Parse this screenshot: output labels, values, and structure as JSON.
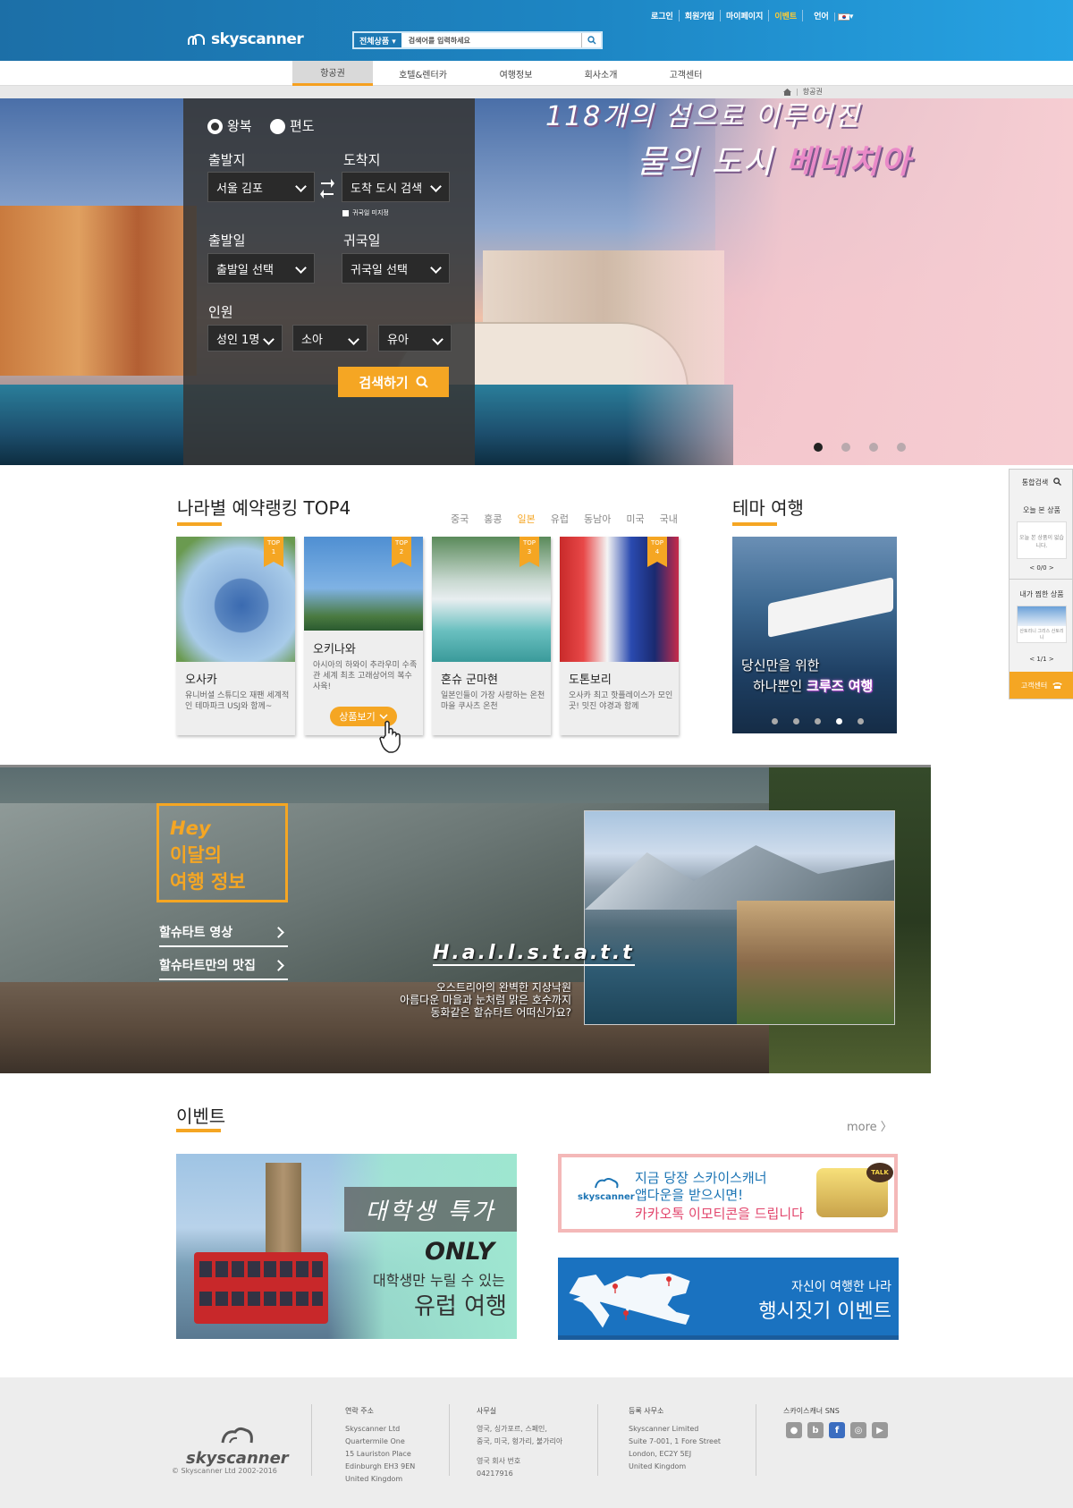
{
  "header": {
    "logo": "skyscanner",
    "search_category": "전체상품 ▾",
    "search_placeholder": "검색어를 입력하세요",
    "links": [
      "로그인",
      "회원가입",
      "마이페이지",
      "이벤트",
      "언어"
    ]
  },
  "nav": {
    "items": [
      "항공권",
      "호텔&렌터카",
      "여행정보",
      "회사소개",
      "고객센터"
    ],
    "active": "항공권"
  },
  "breadcrumb": {
    "current": "항공권"
  },
  "hero": {
    "title_line1": "118개의 섬으로 이루어진",
    "title_line2_prefix": "물의 도시",
    "title_line2_highlight": "베네치아",
    "slides": 4,
    "active_slide": 1
  },
  "booking": {
    "roundtrip": "왕복",
    "oneway": "편도",
    "from_label": "출발지",
    "from_value": "서울 김포",
    "to_label": "도착지",
    "to_value": "도착 도시 검색",
    "no_return": "귀국일 미지정",
    "depart_label": "출발일",
    "depart_value": "출발일 선택",
    "return_label": "귀국일",
    "return_value": "귀국일 선택",
    "people_label": "인원",
    "adult": "성인 1명",
    "child": "소아",
    "infant": "유아",
    "search_button": "검색하기"
  },
  "ranking": {
    "title": "나라별 예약랭킹 TOP4",
    "tabs": [
      "중국",
      "홍콩",
      "일본",
      "유럽",
      "동남아",
      "미국",
      "국내"
    ],
    "active_tab": "일본",
    "cards": [
      {
        "badge_top": "TOP",
        "badge_num": "1",
        "title": "오사카",
        "desc": "유니버셜 스튜디오 재팬 세계적인 테마파크 USJ와 함께~"
      },
      {
        "badge_top": "TOP",
        "badge_num": "2",
        "title": "오키나와",
        "desc": "아시아의 하와이 추라우미 수족관 세계 최초 고래상어의 복수 사육!",
        "button": "상품보기"
      },
      {
        "badge_top": "TOP",
        "badge_num": "3",
        "title": "혼슈 군마현",
        "desc": "일본인들이 가장 사랑하는 온천마을 쿠사츠 온천"
      },
      {
        "badge_top": "TOP",
        "badge_num": "4",
        "title": "도톤보리",
        "desc": "오사카 최고 핫플레이스가 모인 곳! 밋진 야경과 함께"
      }
    ]
  },
  "theme": {
    "title": "테마 여행",
    "line1": "당신만을 위한",
    "line2_prefix": "하나뿐인",
    "line2_highlight": "크루즈 여행",
    "slides": 5,
    "active_slide": 4
  },
  "sidebar": {
    "search": "통합검색",
    "recent_title": "오늘 본 상품",
    "recent_empty": "오늘 본 상품이 없습니다.",
    "recent_pager": "< 0/0 >",
    "wish_title": "내가 찜한 상품",
    "wish_item": "산토리니 그리스 산토리니",
    "wish_pager": "< 1/1 >",
    "cs": "고객센터"
  },
  "hallstatt": {
    "hey": "Hey",
    "box_line1": "이달의",
    "box_line2": "여행 정보",
    "link1": "할슈타트 영상",
    "link2": "할슈타트만의 맛집",
    "name": "H.a.l.l.s.t.a.t.t",
    "desc1": "오스트리아의 완벽한 지상낙원",
    "desc2": "아름다운 마을과 눈처럼 맑은 호수까지",
    "desc3": "동화같은 할슈타트 어떠신가요?"
  },
  "events": {
    "title": "이벤트",
    "more": "more 〉",
    "student_title": "대학생 특가",
    "student_only": "ONLY",
    "student_sub": "대학생만 누릴 수 있는",
    "student_main": "유럽 여행",
    "app_logo": "skyscanner",
    "app_line1": "지금 당장 스카이스캐너",
    "app_line2": "앱다운을 받으시면!",
    "app_line3": "카카오톡 이모티콘을 드립니다",
    "map_line1": "자신이 여행한 나라",
    "map_line2": "행시짓기 이벤트"
  },
  "footer": {
    "logo": "skyscanner",
    "copyright": "© Skyscanner Ltd 2002-2016",
    "contact_title": "연락 주소",
    "contact_lines": [
      "Skyscanner Ltd",
      "Quartermile One",
      "15 Lauriston Place",
      "Edinburgh EH3 9EN",
      "United Kingdom"
    ],
    "office_title": "사무실",
    "office_lines": [
      "영국, 싱가포르, 스페인,",
      "중국, 미국, 헝가리, 불가리아"
    ],
    "company_no_title": "영국 회사 번호",
    "company_no": "04217916",
    "reg_title": "등록 사무소",
    "reg_lines": [
      "Skyscanner Limited",
      "Suite 7-001, 1 Fore Street",
      "London, EC2Y 5EJ",
      "United Kingdom"
    ],
    "sns_title": "스카이스캐너 SNS"
  },
  "colors": {
    "header": "#1d86c4",
    "accent": "#f5a623",
    "event_blue": "#1a72c0",
    "pink": "#e98ac8"
  }
}
